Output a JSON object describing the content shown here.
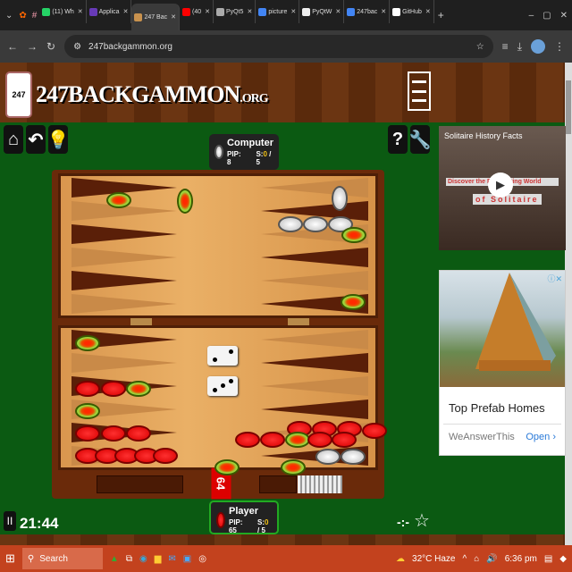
{
  "browser": {
    "tabs": [
      {
        "label": "(11) Wh",
        "icon": "whatsapp-icon",
        "color": "#25d366"
      },
      {
        "label": "Applica",
        "icon": "forms-icon",
        "color": "#673ab7"
      },
      {
        "label": "247 Bac",
        "icon": "backgammon-icon",
        "color": "#c9924e",
        "active": true
      },
      {
        "label": "(40",
        "icon": "youtube-icon",
        "color": "#ff0000"
      },
      {
        "label": "PyQt5",
        "icon": "pyqt-icon",
        "color": "#aaaaaa"
      },
      {
        "label": "picture",
        "icon": "google-icon",
        "color": "#4285f4"
      },
      {
        "label": "PyQtW",
        "icon": "pyqt-icon",
        "color": "#eeeeee"
      },
      {
        "label": "247bac",
        "icon": "google-icon",
        "color": "#4285f4"
      },
      {
        "label": "GitHub",
        "icon": "github-icon",
        "color": "#ffffff"
      }
    ],
    "url": "247backgammon.org"
  },
  "site": {
    "logo_number": "247",
    "logo_text": "247BACKGAMMON",
    "logo_suffix": ".ORG"
  },
  "computer": {
    "name": "Computer",
    "pip": "PIP: 8",
    "score_label": "S:",
    "score": "0",
    "score_total": "/ 5"
  },
  "player": {
    "name": "Player",
    "pip": "PIP: 65",
    "score_label": "S:",
    "score": "0",
    "score_total": "/ 5"
  },
  "game": {
    "timer": "21:44",
    "doubling_cube": "64",
    "dice": [
      2,
      3
    ]
  },
  "ads": {
    "video_title": "Solitaire History Facts",
    "video_caption_1": "Discover the Fascinating World",
    "video_caption_2": "of Solitaire",
    "ad_title": "Top Prefab Homes",
    "ad_source": "WeAnswerThis",
    "ad_cta": "Open ›"
  },
  "taskbar": {
    "search": "Search",
    "weather": "32°C  Haze",
    "time": "6:36 pm"
  },
  "colors": {
    "felt": "#0b5a12",
    "wood": "#6a2a0a",
    "taskbar": "#c3421e"
  }
}
